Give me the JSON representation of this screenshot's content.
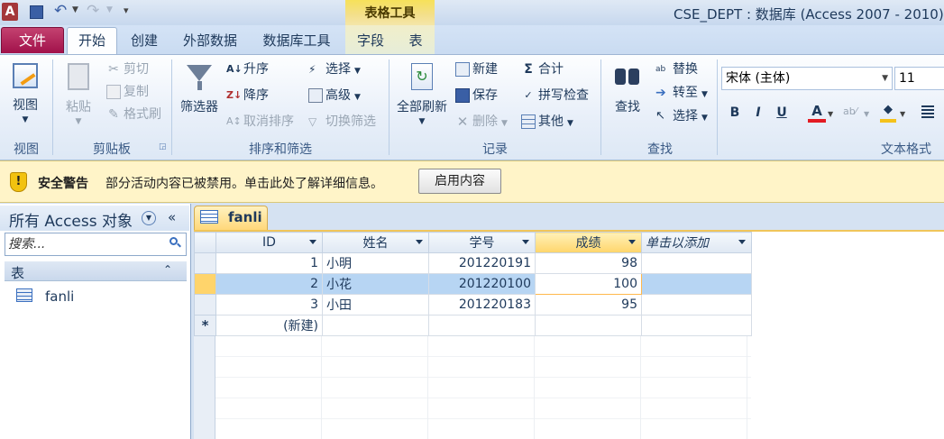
{
  "app": {
    "title": "CSE_DEPT : 数据库 (Access 2007 - 2010)",
    "logo_letter": "A"
  },
  "ribbon_tabs": {
    "file": "文件",
    "home": "开始",
    "create": "创建",
    "external": "外部数据",
    "dbtools": "数据库工具",
    "context_group": "表格工具",
    "field": "字段",
    "table": "表"
  },
  "groups": {
    "view": {
      "label": "视图",
      "btn": "视图"
    },
    "clipboard": {
      "label": "剪贴板",
      "paste": "粘贴",
      "cut": "剪切",
      "copy": "复制",
      "format_painter": "格式刷"
    },
    "sortfilter": {
      "label": "排序和筛选",
      "filter": "筛选器",
      "asc": "升序",
      "desc": "降序",
      "clear_sort": "取消排序",
      "select": "选择",
      "advanced": "高级",
      "toggle": "切换筛选"
    },
    "records": {
      "label": "记录",
      "refresh": "全部刷新",
      "new": "新建",
      "save": "保存",
      "delete": "删除",
      "totals": "合计",
      "spelling": "拼写检查",
      "more": "其他"
    },
    "find": {
      "label": "查找",
      "find": "查找",
      "replace": "替换",
      "goto": "转至",
      "select": "选择"
    },
    "text": {
      "label": "文本格式",
      "font": "宋体 (主体)",
      "size": "11"
    }
  },
  "security": {
    "title": "安全警告",
    "message": "部分活动内容已被禁用。单击此处了解详细信息。",
    "button": "启用内容"
  },
  "nav": {
    "title": "所有 Access 对象",
    "search_placeholder": "搜索...",
    "category": "表",
    "items": [
      {
        "label": "fanli"
      }
    ]
  },
  "doc": {
    "tab": "fanli"
  },
  "table": {
    "columns": [
      "ID",
      "姓名",
      "学号",
      "成绩",
      "单击以添加"
    ],
    "rows": [
      {
        "id": "1",
        "name": "小明",
        "num": "201220191",
        "score": "98"
      },
      {
        "id": "2",
        "name": "小花",
        "num": "201220100",
        "score": "100"
      },
      {
        "id": "3",
        "name": "小田",
        "num": "201220183",
        "score": "95"
      }
    ],
    "new_row": "(新建)",
    "new_marker": "*"
  },
  "colors": {
    "file_tab": "#a1114a",
    "security_bar": "#fff4c8",
    "selected_row": "#b7d5f3",
    "active_header": "#ffd56b"
  }
}
